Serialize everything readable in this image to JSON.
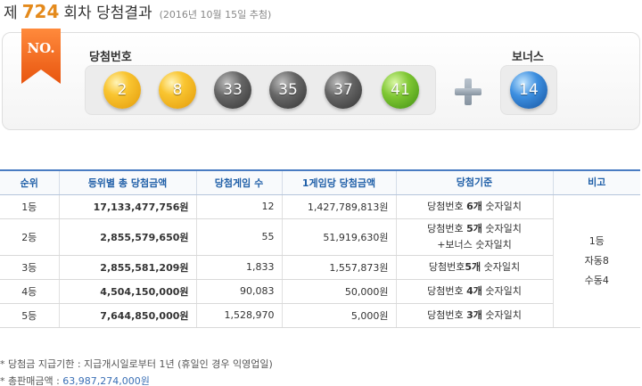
{
  "header": {
    "prefix": "제",
    "round": "724",
    "suffix": "회차 당첨결과",
    "date": "(2016년 10월 15일 추첨)"
  },
  "draw": {
    "badge": "NO.",
    "winning_label": "당첨번호",
    "bonus_label": "보너스",
    "numbers": [
      "2",
      "8",
      "33",
      "35",
      "37",
      "41"
    ],
    "bonus": "14",
    "colors": {
      "yellow": "#f9c531",
      "gray": "#555555",
      "green": "#7fc733",
      "blue": "#3d8fe0",
      "badge": "#f36f21"
    }
  },
  "table": {
    "headers": [
      "순위",
      "등위별 총 당첨금액",
      "당첨게임 수",
      "1게임당 당첨금액",
      "당첨기준",
      "비고"
    ],
    "rows": [
      {
        "rank": "1등",
        "total": "17,133,477,756원",
        "count": "12",
        "each": "1,427,789,813원",
        "crit_pre": "당첨번호 ",
        "crit_strong": "6개",
        "crit_post": " 숫자일치",
        "crit_line2": ""
      },
      {
        "rank": "2등",
        "total": "2,855,579,650원",
        "count": "55",
        "each": "51,919,630원",
        "crit_pre": "당첨번호 ",
        "crit_strong": "5개",
        "crit_post": " 숫자일치",
        "crit_line2": "+보너스 숫자일치"
      },
      {
        "rank": "3등",
        "total": "2,855,581,209원",
        "count": "1,833",
        "each": "1,557,873원",
        "crit_pre": "당첨번호",
        "crit_strong": "5개",
        "crit_post": " 숫자일치",
        "crit_line2": ""
      },
      {
        "rank": "4등",
        "total": "4,504,150,000원",
        "count": "90,083",
        "each": "50,000원",
        "crit_pre": "당첨번호 ",
        "crit_strong": "4개",
        "crit_post": " 숫자일치",
        "crit_line2": ""
      },
      {
        "rank": "5등",
        "total": "7,644,850,000원",
        "count": "1,528,970",
        "each": "5,000원",
        "crit_pre": "당첨번호 ",
        "crit_strong": "3개",
        "crit_post": " 숫자일치",
        "crit_line2": ""
      }
    ],
    "note": [
      "1등",
      "자동8",
      "수동4"
    ]
  },
  "footer": {
    "deadline": "* 당첨금 지급기한 : 지급개시일로부터 1년 (휴일인 경우 익영업일)",
    "sales_label": "* 총판매금액 : ",
    "sales_amount": "63,987,274,000원"
  }
}
